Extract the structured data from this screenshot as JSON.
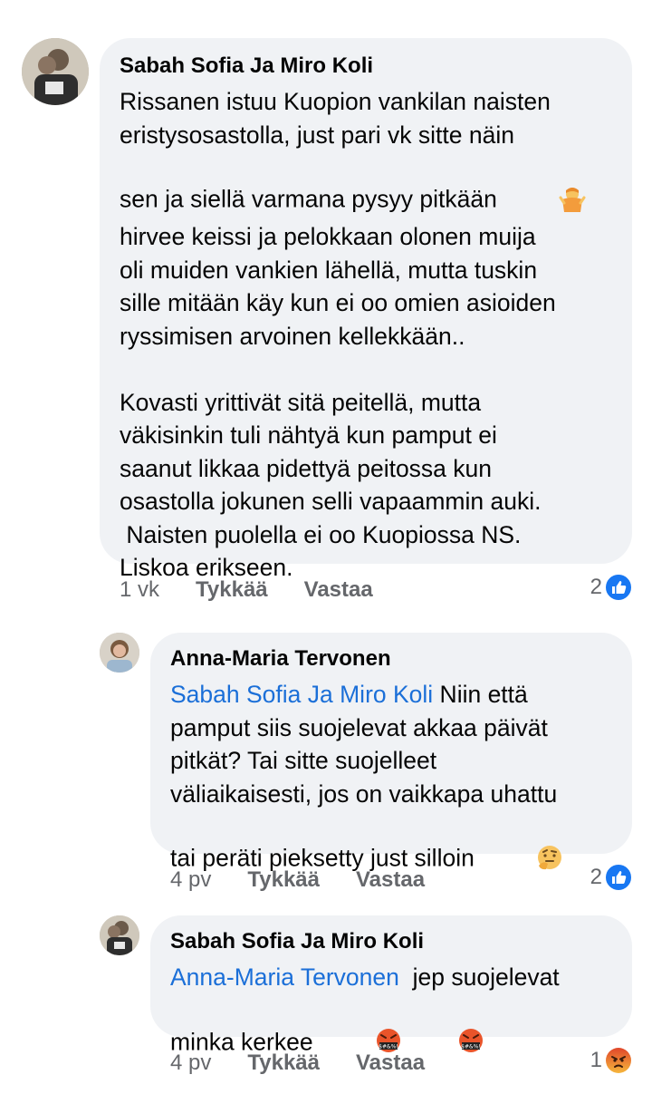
{
  "comments": [
    {
      "author": "Sabah Sofia Ja Miro Koli",
      "paragraph1": "Rissanen istuu Kuopion vankilan naisten\neristysosastolla, just pari vk sitte näin\nsen ja siellä varmana pysyy pitkään",
      "paragraph1b": "\nhirvee keissi ja pelokkaan olonen muija\noli muiden vankien lähellä, mutta tuskin\nsille mitään käy kun ei oo omien asioiden\nryssimisen arvoinen kellekkään..\n\nKovasti yrittivät sitä peitellä, mutta\nväkisinkin tuli nähtyä kun pamput ei\nsaanut likkaa pidettyä peitossa kun\nosastolla jokunen selli vapaammin auki.\n Naisten puolella ei oo Kuopiossa NS.\nLiskoa erikseen.",
      "time": "1 vk",
      "like_label": "Tykkää",
      "reply_label": "Vastaa",
      "reaction_count": "2",
      "reaction_icon": "like-icon",
      "emoji": "person-shrugging-emoji"
    },
    {
      "author": "Anna-Maria Tervonen",
      "mention": "Sabah Sofia Ja Miro Koli",
      "text": " Niin että\npamput siis suojelevat akkaa päivät\npitkät? Tai sitte suojelleet\nväliaikaisesti, jos on vaikkapa uhattu\ntai peräti pieksetty just silloin ",
      "time": "4 pv",
      "like_label": "Tykkää",
      "reply_label": "Vastaa",
      "reaction_count": "2",
      "reaction_icon": "like-icon",
      "emoji": "thinking-face-emoji"
    },
    {
      "author": "Sabah Sofia Ja Miro Koli",
      "mention": "Anna-Maria Tervonen",
      "text": "  jep suojelevat\nminka kerkee ",
      "time": "4 pv",
      "like_label": "Tykkää",
      "reply_label": "Vastaa",
      "reaction_count": "1",
      "reaction_icon": "angry-icon",
      "emoji": "face-with-symbols-emoji"
    }
  ],
  "colors": {
    "bubble": "#f0f2f5",
    "mention": "#1b6fd8",
    "meta": "#65676b",
    "like": "#1877f2",
    "angry": "#e9710f"
  }
}
